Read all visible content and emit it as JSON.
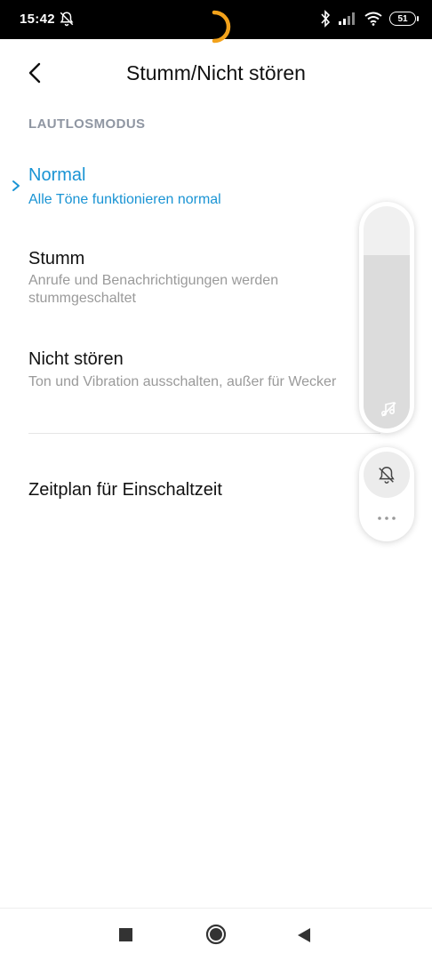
{
  "status_bar": {
    "time": "15:42",
    "battery": "51",
    "icons": [
      "bell-off-icon",
      "bluetooth-icon",
      "signal-icon",
      "wifi-icon",
      "battery-icon"
    ]
  },
  "header": {
    "title": "Stumm/Nicht stören",
    "back_icon": "back-arrow-icon"
  },
  "section": {
    "label": "LAUTLOSMODUS"
  },
  "options": [
    {
      "title": "Normal",
      "description": "Alle Töne funktionieren normal",
      "selected": true
    },
    {
      "title": "Stumm",
      "description_lines": [
        "Anrufe und Benachrichtigungen werden",
        "stummgeschaltet"
      ],
      "selected": false
    },
    {
      "title": "Nicht stören",
      "description": "Ton und Vibration ausschalten, außer für Wecker",
      "selected": false
    }
  ],
  "schedule": {
    "label": "Zeitplan für Einschaltzeit"
  },
  "volume_panel": {
    "level_fraction": 0.78,
    "icon": "music-note-off-icon",
    "mode_icon": "bell-off-icon",
    "more_icon": "more-dots-icon"
  },
  "colors": {
    "accent": "#1a94d4",
    "secondary_text": "#9a9a9a",
    "section_label": "#8f96a2",
    "spinner": "#f2a21b"
  },
  "nav_bar": {
    "icons": [
      "recent-apps-icon",
      "home-icon",
      "back-icon"
    ]
  }
}
